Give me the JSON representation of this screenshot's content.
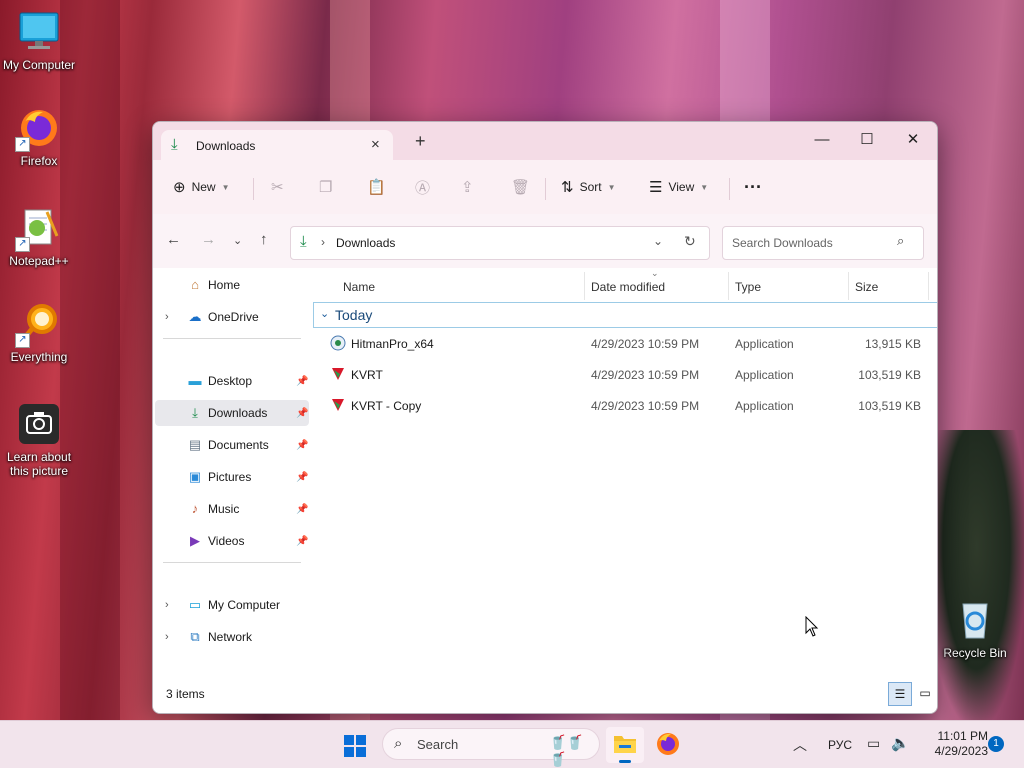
{
  "desktop": {
    "icons": [
      {
        "label": "My Computer"
      },
      {
        "label": "Firefox"
      },
      {
        "label": "Notepad++"
      },
      {
        "label": "Everything"
      },
      {
        "label": "Learn about this picture"
      },
      {
        "label": "Recycle Bin"
      }
    ]
  },
  "window": {
    "tab_title": "Downloads",
    "controls": {
      "minimize": "—",
      "maximize": "☐",
      "close": "✕"
    },
    "toolbar": {
      "new_label": "New",
      "sort_label": "Sort",
      "view_label": "View",
      "more_label": "···"
    },
    "address": {
      "path": "Downloads",
      "search_placeholder": "Search Downloads"
    },
    "sidebar": {
      "items": [
        {
          "label": "Home"
        },
        {
          "label": "OneDrive"
        },
        {
          "label": "Desktop"
        },
        {
          "label": "Downloads"
        },
        {
          "label": "Documents"
        },
        {
          "label": "Pictures"
        },
        {
          "label": "Music"
        },
        {
          "label": "Videos"
        },
        {
          "label": "My Computer"
        },
        {
          "label": "Network"
        }
      ]
    },
    "columns": {
      "name": "Name",
      "date": "Date modified",
      "type": "Type",
      "size": "Size"
    },
    "group_label": "Today",
    "files": [
      {
        "name": "HitmanPro_x64",
        "date": "4/29/2023 10:59 PM",
        "type": "Application",
        "size": "13,915 KB"
      },
      {
        "name": "KVRT",
        "date": "4/29/2023 10:59 PM",
        "type": "Application",
        "size": "103,519 KB"
      },
      {
        "name": "KVRT - Copy",
        "date": "4/29/2023 10:59 PM",
        "type": "Application",
        "size": "103,519 KB"
      }
    ],
    "status_text": "3 items"
  },
  "taskbar": {
    "search_label": "Search",
    "language": "РУС",
    "time": "11:01 PM",
    "date": "4/29/2023",
    "notification_count": "1"
  },
  "colors": {
    "accent": "#0067c0",
    "download_green": "#1a8a4a",
    "titlebar": "#f4dce6",
    "taskbar": "#f2e4ec"
  }
}
